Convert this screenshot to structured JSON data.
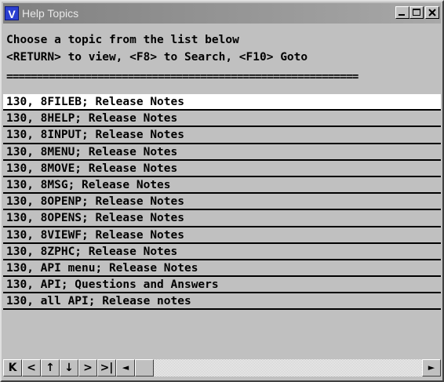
{
  "window": {
    "app_icon_letter": "V",
    "title": "Help Topics"
  },
  "header": {
    "line1": "Choose a topic from the list below",
    "line2": "<RETURN> to view, <F8> to Search, <F10> Goto",
    "separator": "=========================================================="
  },
  "topics": [
    "130, 8FILEB; Release Notes",
    "130, 8HELP; Release Notes",
    "130, 8INPUT; Release Notes",
    "130, 8MENU; Release Notes",
    "130, 8MOVE; Release Notes",
    "130, 8MSG; Release Notes",
    "130, 8OPENP; Release Notes",
    "130, 8OPENS; Release Notes",
    "130, 8VIEWF; Release Notes",
    "130, 8ZPHC; Release Notes",
    "130, API menu; Release Notes",
    "130, API; Questions and Answers",
    "130, all API; Release notes"
  ],
  "selected_index": 0,
  "nav": {
    "first": "K",
    "prev": "<",
    "up": "↑",
    "down": "↓",
    "next": ">",
    "last": ">|",
    "scroll_left": "◄",
    "scroll_right": "►"
  }
}
